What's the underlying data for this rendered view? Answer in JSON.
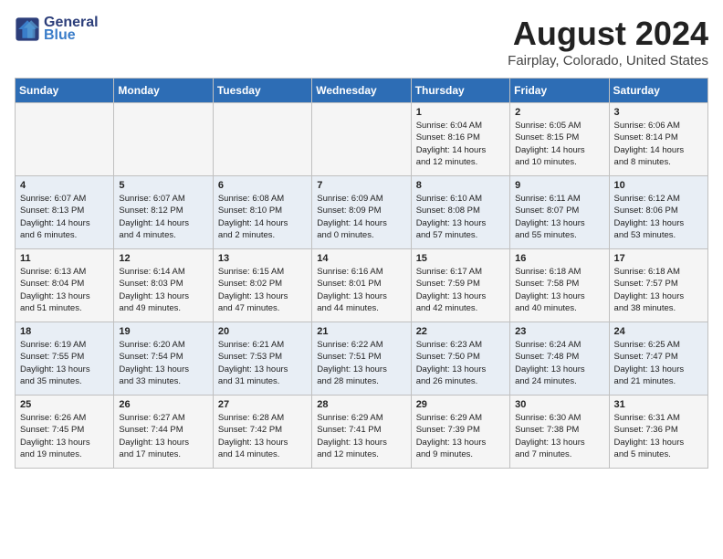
{
  "header": {
    "logo_line1": "General",
    "logo_line2": "Blue",
    "title": "August 2024",
    "subtitle": "Fairplay, Colorado, United States"
  },
  "weekdays": [
    "Sunday",
    "Monday",
    "Tuesday",
    "Wednesday",
    "Thursday",
    "Friday",
    "Saturday"
  ],
  "weeks": [
    [
      {
        "day": "",
        "content": ""
      },
      {
        "day": "",
        "content": ""
      },
      {
        "day": "",
        "content": ""
      },
      {
        "day": "",
        "content": ""
      },
      {
        "day": "1",
        "content": "Sunrise: 6:04 AM\nSunset: 8:16 PM\nDaylight: 14 hours\nand 12 minutes."
      },
      {
        "day": "2",
        "content": "Sunrise: 6:05 AM\nSunset: 8:15 PM\nDaylight: 14 hours\nand 10 minutes."
      },
      {
        "day": "3",
        "content": "Sunrise: 6:06 AM\nSunset: 8:14 PM\nDaylight: 14 hours\nand 8 minutes."
      }
    ],
    [
      {
        "day": "4",
        "content": "Sunrise: 6:07 AM\nSunset: 8:13 PM\nDaylight: 14 hours\nand 6 minutes."
      },
      {
        "day": "5",
        "content": "Sunrise: 6:07 AM\nSunset: 8:12 PM\nDaylight: 14 hours\nand 4 minutes."
      },
      {
        "day": "6",
        "content": "Sunrise: 6:08 AM\nSunset: 8:10 PM\nDaylight: 14 hours\nand 2 minutes."
      },
      {
        "day": "7",
        "content": "Sunrise: 6:09 AM\nSunset: 8:09 PM\nDaylight: 14 hours\nand 0 minutes."
      },
      {
        "day": "8",
        "content": "Sunrise: 6:10 AM\nSunset: 8:08 PM\nDaylight: 13 hours\nand 57 minutes."
      },
      {
        "day": "9",
        "content": "Sunrise: 6:11 AM\nSunset: 8:07 PM\nDaylight: 13 hours\nand 55 minutes."
      },
      {
        "day": "10",
        "content": "Sunrise: 6:12 AM\nSunset: 8:06 PM\nDaylight: 13 hours\nand 53 minutes."
      }
    ],
    [
      {
        "day": "11",
        "content": "Sunrise: 6:13 AM\nSunset: 8:04 PM\nDaylight: 13 hours\nand 51 minutes."
      },
      {
        "day": "12",
        "content": "Sunrise: 6:14 AM\nSunset: 8:03 PM\nDaylight: 13 hours\nand 49 minutes."
      },
      {
        "day": "13",
        "content": "Sunrise: 6:15 AM\nSunset: 8:02 PM\nDaylight: 13 hours\nand 47 minutes."
      },
      {
        "day": "14",
        "content": "Sunrise: 6:16 AM\nSunset: 8:01 PM\nDaylight: 13 hours\nand 44 minutes."
      },
      {
        "day": "15",
        "content": "Sunrise: 6:17 AM\nSunset: 7:59 PM\nDaylight: 13 hours\nand 42 minutes."
      },
      {
        "day": "16",
        "content": "Sunrise: 6:18 AM\nSunset: 7:58 PM\nDaylight: 13 hours\nand 40 minutes."
      },
      {
        "day": "17",
        "content": "Sunrise: 6:18 AM\nSunset: 7:57 PM\nDaylight: 13 hours\nand 38 minutes."
      }
    ],
    [
      {
        "day": "18",
        "content": "Sunrise: 6:19 AM\nSunset: 7:55 PM\nDaylight: 13 hours\nand 35 minutes."
      },
      {
        "day": "19",
        "content": "Sunrise: 6:20 AM\nSunset: 7:54 PM\nDaylight: 13 hours\nand 33 minutes."
      },
      {
        "day": "20",
        "content": "Sunrise: 6:21 AM\nSunset: 7:53 PM\nDaylight: 13 hours\nand 31 minutes."
      },
      {
        "day": "21",
        "content": "Sunrise: 6:22 AM\nSunset: 7:51 PM\nDaylight: 13 hours\nand 28 minutes."
      },
      {
        "day": "22",
        "content": "Sunrise: 6:23 AM\nSunset: 7:50 PM\nDaylight: 13 hours\nand 26 minutes."
      },
      {
        "day": "23",
        "content": "Sunrise: 6:24 AM\nSunset: 7:48 PM\nDaylight: 13 hours\nand 24 minutes."
      },
      {
        "day": "24",
        "content": "Sunrise: 6:25 AM\nSunset: 7:47 PM\nDaylight: 13 hours\nand 21 minutes."
      }
    ],
    [
      {
        "day": "25",
        "content": "Sunrise: 6:26 AM\nSunset: 7:45 PM\nDaylight: 13 hours\nand 19 minutes."
      },
      {
        "day": "26",
        "content": "Sunrise: 6:27 AM\nSunset: 7:44 PM\nDaylight: 13 hours\nand 17 minutes."
      },
      {
        "day": "27",
        "content": "Sunrise: 6:28 AM\nSunset: 7:42 PM\nDaylight: 13 hours\nand 14 minutes."
      },
      {
        "day": "28",
        "content": "Sunrise: 6:29 AM\nSunset: 7:41 PM\nDaylight: 13 hours\nand 12 minutes."
      },
      {
        "day": "29",
        "content": "Sunrise: 6:29 AM\nSunset: 7:39 PM\nDaylight: 13 hours\nand 9 minutes."
      },
      {
        "day": "30",
        "content": "Sunrise: 6:30 AM\nSunset: 7:38 PM\nDaylight: 13 hours\nand 7 minutes."
      },
      {
        "day": "31",
        "content": "Sunrise: 6:31 AM\nSunset: 7:36 PM\nDaylight: 13 hours\nand 5 minutes."
      }
    ]
  ]
}
